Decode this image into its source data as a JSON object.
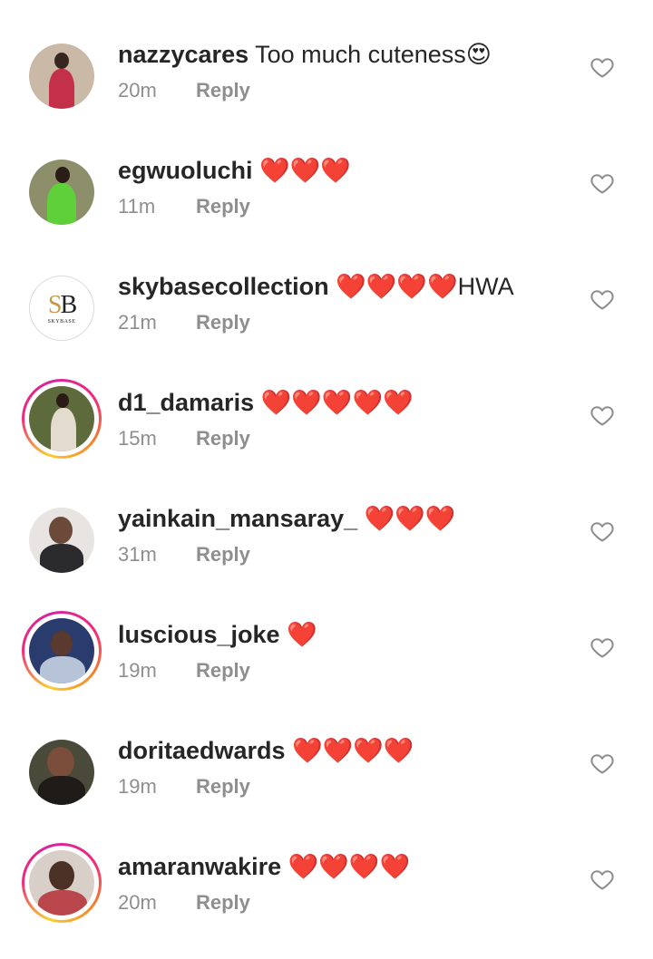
{
  "comments": [
    {
      "username": "nazzycares",
      "text": " Too much cuteness😍",
      "time": "20m",
      "reply": "Reply",
      "story": false,
      "avatar": {
        "bg": "#c9b9a6",
        "body": "#c42f4a",
        "head": "#3a2620"
      }
    },
    {
      "username": "egwuoluchi",
      "text": " ❤️❤️❤️",
      "time": "11m",
      "reply": "Reply",
      "story": false,
      "avatar": {
        "bg": "#8c8f6a",
        "body": "#5fd03a",
        "head": "#2a1c16"
      }
    },
    {
      "username": "skybasecollection",
      "text": " ❤️❤️❤️❤️HWA",
      "time": "21m",
      "reply": "Reply",
      "story": false,
      "logo": {
        "mark_s": "S",
        "mark_b": "B",
        "caption": "SKYBASE"
      }
    },
    {
      "username": "d1_damaris",
      "text": " ❤️❤️❤️❤️❤️",
      "time": "15m",
      "reply": "Reply",
      "story": true,
      "avatar": {
        "bg": "#5c6a3c",
        "body": "#e4dbcf",
        "head": "#2b1b14"
      }
    },
    {
      "username": "yainkain_mansaray_",
      "text": " ❤️❤️❤️",
      "time": "31m",
      "reply": "Reply",
      "story": false,
      "avatar": {
        "bg": "#e7e4e2",
        "body": "#2b2b2e",
        "head": "#6b4a3a"
      }
    },
    {
      "username": "luscious_joke",
      "text": " ❤️",
      "time": "19m",
      "reply": "Reply",
      "story": true,
      "avatar": {
        "bg": "#2a3b6e",
        "body": "#b7c3d6",
        "head": "#5a3a2e"
      }
    },
    {
      "username": "doritaedwards",
      "text": " ❤️❤️❤️❤️",
      "time": "19m",
      "reply": "Reply",
      "story": false,
      "avatar": {
        "bg": "#4a4a3a",
        "body": "#1f1b18",
        "head": "#7a4e3a"
      }
    },
    {
      "username": "amaranwakire",
      "text": " ❤️❤️❤️❤️",
      "time": "20m",
      "reply": "Reply",
      "story": true,
      "avatar": {
        "bg": "#d8cfc8",
        "body": "#b9464a",
        "head": "#4b3025"
      }
    }
  ]
}
